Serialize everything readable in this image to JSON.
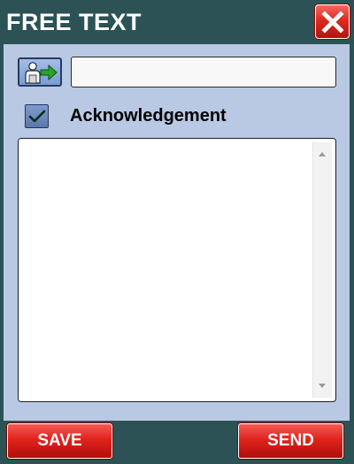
{
  "window": {
    "title": "FREE TEXT",
    "close_icon": "close-x-icon"
  },
  "recipient": {
    "button_icon": "user-arrow-icon",
    "value": "",
    "placeholder": ""
  },
  "acknowledgement": {
    "checked": true,
    "label": "Acknowledgement"
  },
  "message": {
    "value": ""
  },
  "footer": {
    "save_label": "SAVE",
    "send_label": "SEND"
  },
  "colors": {
    "frame": "#2c5255",
    "panel": "#b9c9e3",
    "button_red": "#e0231d",
    "checkbox_blue": "#6d8bbf",
    "arrow_green": "#2aa52a"
  }
}
